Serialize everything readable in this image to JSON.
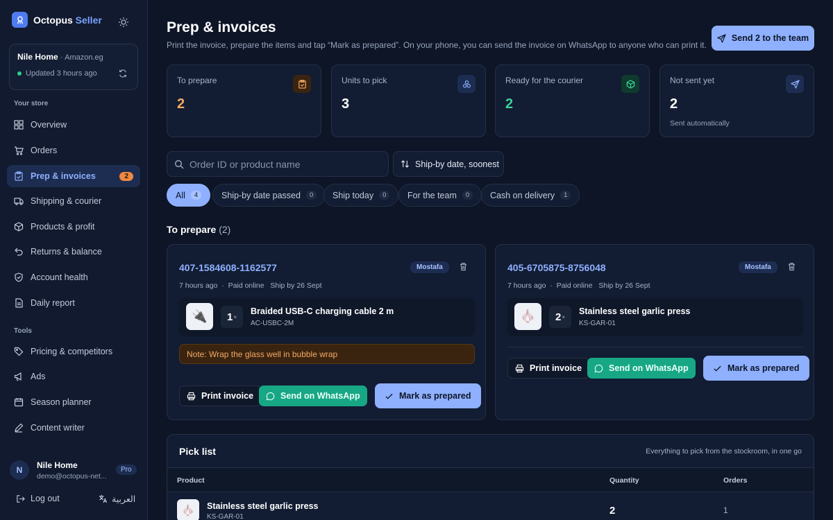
{
  "app": {
    "name_part1": "Octopus",
    "name_part2": "Seller"
  },
  "store": {
    "name": "Nile Home",
    "marketplace": "· Amazon.eg",
    "updated": "Updated 3 hours ago"
  },
  "sidebar": {
    "section_store": "Your store",
    "items": [
      {
        "label": "Overview",
        "icon": "grid-icon"
      },
      {
        "label": "Orders",
        "icon": "cart-icon"
      },
      {
        "label": "Prep & invoices",
        "icon": "clipboard-icon",
        "badge": "2",
        "active": true
      },
      {
        "label": "Shipping & courier",
        "icon": "truck-icon"
      },
      {
        "label": "Products & profit",
        "icon": "box-icon"
      },
      {
        "label": "Returns & balance",
        "icon": "return-icon"
      },
      {
        "label": "Account health",
        "icon": "shield-icon"
      },
      {
        "label": "Daily report",
        "icon": "document-icon"
      }
    ],
    "section_tools": "Tools",
    "tools": [
      {
        "label": "Pricing & competitors",
        "icon": "tag-icon"
      },
      {
        "label": "Ads",
        "icon": "megaphone-icon"
      },
      {
        "label": "Season planner",
        "icon": "calendar-icon"
      },
      {
        "label": "Content writer",
        "icon": "pen-icon"
      }
    ]
  },
  "user": {
    "initial": "N",
    "name": "Nile Home",
    "email": "demo@octopus-net...",
    "plan": "Pro"
  },
  "footer": {
    "logout": "Log out",
    "language": "العربية"
  },
  "page": {
    "title": "Prep & invoices",
    "subtitle": "Print the invoice, prepare the items and tap “Mark as prepared”. On your phone, you can send the invoice on WhatsApp to anyone who can print it.",
    "send_button": "Send 2 to the team"
  },
  "stats": [
    {
      "label": "To prepare",
      "value": "2",
      "color": "#f5a965",
      "icon": "clipboard-icon"
    },
    {
      "label": "Units to pick",
      "value": "3",
      "color": "#ffffff",
      "icon": "cubes-icon"
    },
    {
      "label": "Ready for the courier",
      "value": "2",
      "color": "#3ad29f",
      "icon": "package-icon"
    },
    {
      "label": "Not sent yet",
      "value": "2",
      "color": "#ffffff",
      "sub": "Sent automatically",
      "icon": "send-icon"
    }
  ],
  "search": {
    "placeholder": "Order ID or product name",
    "value": ""
  },
  "sort": {
    "label": "Ship-by date, soonest"
  },
  "filters": [
    {
      "label": "All",
      "count": "4",
      "active": true
    },
    {
      "label": "Ship-by date passed",
      "count": "0"
    },
    {
      "label": "Ship today",
      "count": "0"
    },
    {
      "label": "For the team",
      "count": "0"
    },
    {
      "label": "Cash on delivery",
      "count": "1"
    }
  ],
  "section": {
    "title": "To prepare",
    "count": "(2)"
  },
  "orders": [
    {
      "id": "407-1584608-1162577",
      "assignee": "Mostafa",
      "time": "7 hours ago",
      "payment": "Paid online",
      "ship_by": "Ship by 26 Sept",
      "item": {
        "qty": "1",
        "name": "Braided USB-C charging cable 2 m",
        "sku": "AC-USBC-2M",
        "thumb": "🔌"
      },
      "note": "Note: Wrap the glass well in bubble wrap",
      "print": "Print invoice",
      "whatsapp": "Send on WhatsApp",
      "prepared": "Mark as prepared"
    },
    {
      "id": "405-6705875-8756048",
      "assignee": "Mostafa",
      "time": "7 hours ago",
      "payment": "Paid online",
      "ship_by": "Ship by 26 Sept",
      "item": {
        "qty": "2",
        "name": "Stainless steel garlic press",
        "sku": "KS-GAR-01",
        "thumb": "🧄"
      },
      "print": "Print invoice",
      "whatsapp": "Send on WhatsApp",
      "prepared": "Mark as prepared"
    }
  ],
  "pick_list": {
    "title": "Pick list",
    "subtitle": "Everything to pick from the stockroom, in one go",
    "columns": [
      "Product",
      "Quantity",
      "Orders"
    ],
    "rows": [
      {
        "name": "Stainless steel garlic press",
        "sku": "KS-GAR-01",
        "qty": "2",
        "orders": "1",
        "thumb": "🧄"
      }
    ]
  },
  "colors": {
    "accent": "#8fb0ff",
    "warning": "#f5a965",
    "success": "#3ad29f",
    "whatsapp": "#17a785",
    "background": "#0d1526"
  }
}
